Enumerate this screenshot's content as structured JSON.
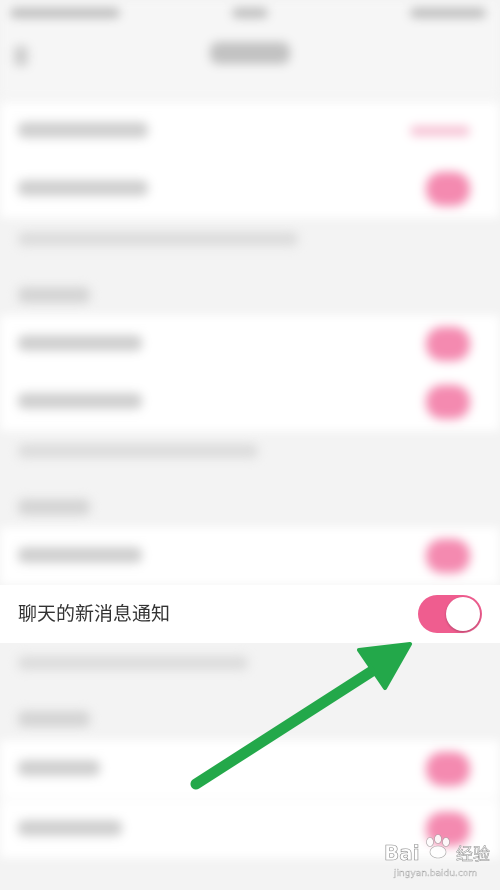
{
  "focused_row": {
    "label": "聊天的新消息通知",
    "toggle_on": true
  },
  "colors": {
    "toggle_on": "#ef5d8f",
    "arrow": "#23a84a"
  },
  "icons": {
    "annotation_arrow": "arrow-icon",
    "watermark": "baidu-jingyan-watermark"
  },
  "watermark": {
    "text": "Bai du 经验",
    "subtext": "jingyan.baidu.com"
  }
}
